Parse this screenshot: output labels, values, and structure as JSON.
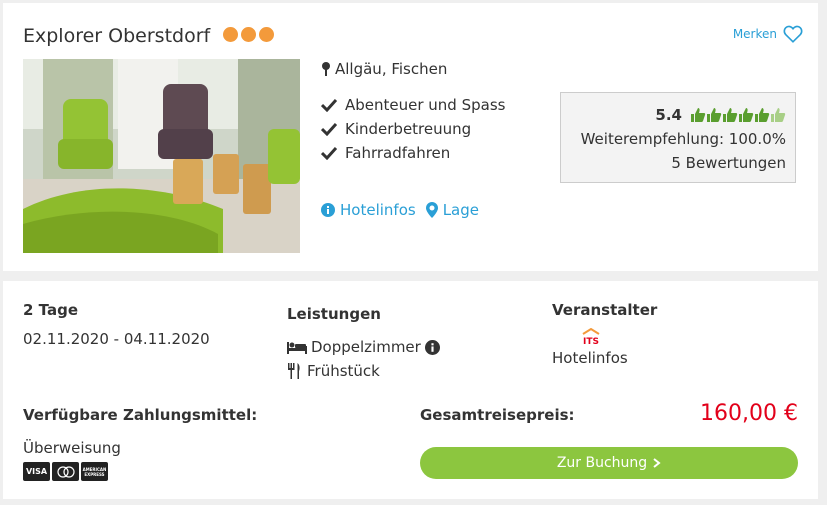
{
  "hotel": {
    "name": "Explorer Oberstdorf",
    "stars": 3,
    "save_label": "Merken",
    "location": "Allgäu, Fischen",
    "features": [
      "Abenteuer und Spass",
      "Kinderbetreuung",
      "Fahrradfahren"
    ],
    "links": {
      "info": "Hotelinfos",
      "location": "Lage"
    }
  },
  "rating": {
    "score": "5.4",
    "thumbs_filled": 5,
    "thumbs_total": 6,
    "recommendation": "Weiterempfehlung: 100.0%",
    "reviews": "5 Bewertungen"
  },
  "offer": {
    "duration": "2 Tage",
    "dates": "02.11.2020 - 04.11.2020",
    "services_title": "Leistungen",
    "room": "Doppelzimmer",
    "board": "Frühstück",
    "operator_title": "Veranstalter",
    "operator_logo": "ITS",
    "operator_link": "Hotelinfos",
    "payment_title": "Verfügbare Zahlungsmittel:",
    "payment_method": "Überweisung",
    "payment_icons": [
      "VISA",
      "Mastercard",
      "American Express"
    ],
    "visa_label": "VISA",
    "amex_label": "AMERICAN EXPRESS",
    "total_title": "Gesamtreisepreis:",
    "total_price": "160,00 €",
    "book_label": "Zur Buchung"
  },
  "colors": {
    "accent": "#2a9fd6",
    "star_orange": "#f39a3b",
    "price_red": "#e2001a",
    "button_green": "#8cc63f",
    "thumb_green": "#5a9e2f"
  }
}
